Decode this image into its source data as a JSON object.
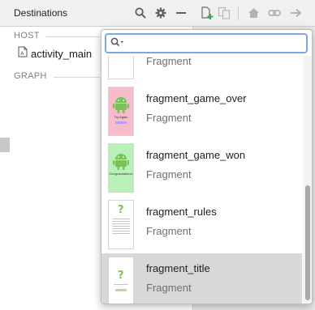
{
  "left_panel": {
    "title": "Destinations",
    "host_label": "HOST",
    "graph_label": "GRAPH",
    "host_item": "activity_main"
  },
  "toolbar": {
    "icons": [
      "search-icon",
      "gear-icon",
      "minus-icon",
      "new-destination-icon",
      "copy-icon",
      "home-icon",
      "link-icon",
      "arrow-right-icon"
    ]
  },
  "popup": {
    "search_value": "",
    "items": [
      {
        "name": "",
        "type": "Fragment",
        "thumb_color": "#ffffff"
      },
      {
        "name": "fragment_game_over",
        "type": "Fragment",
        "thumb_color": "#f5bcc9",
        "thumb_caption": "Try Again"
      },
      {
        "name": "fragment_game_won",
        "type": "Fragment",
        "thumb_color": "#b8f0b8",
        "thumb_caption": "Congratulations!"
      },
      {
        "name": "fragment_rules",
        "type": "Fragment",
        "thumb_color": "#ffffff"
      },
      {
        "name": "fragment_title",
        "type": "Fragment",
        "thumb_color": "#ffffff"
      }
    ]
  },
  "colors": {
    "accent": "#7aa7e6",
    "android_green": "#78c257",
    "selected_row": "#d8d8d8"
  }
}
